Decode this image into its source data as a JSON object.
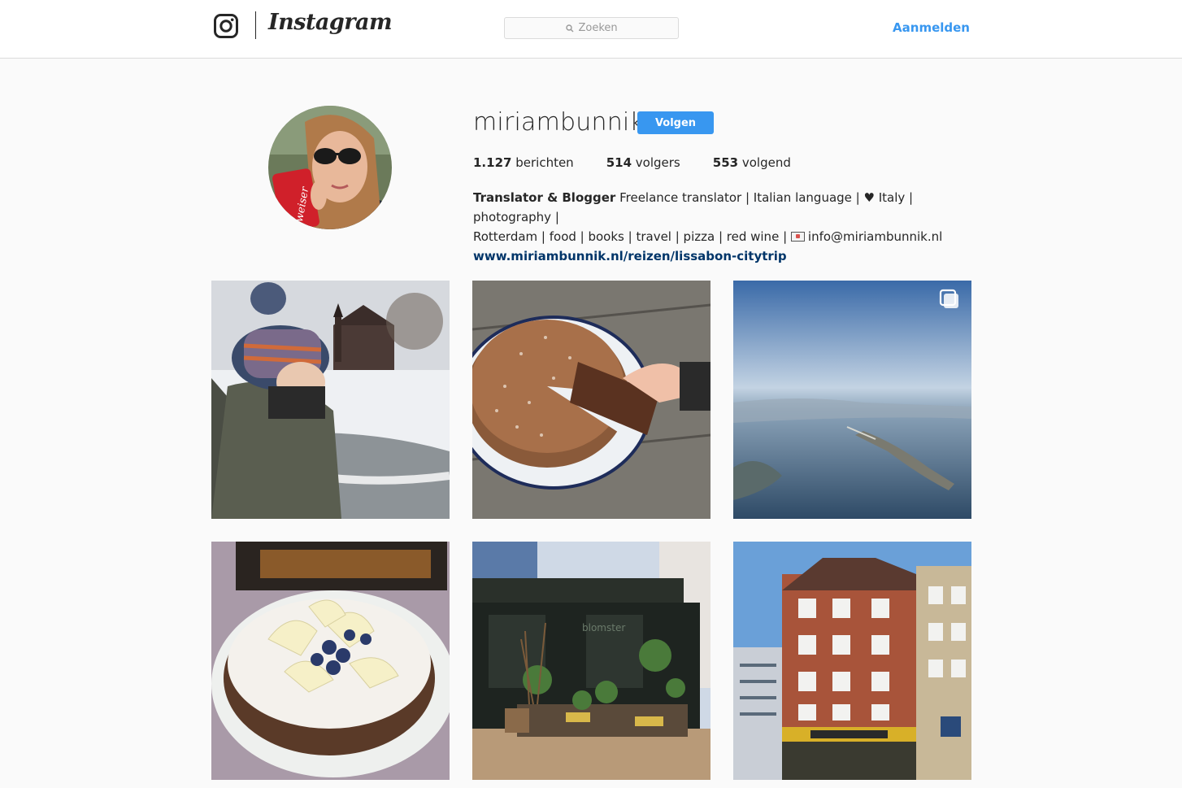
{
  "nav": {
    "brand": "Instagram",
    "search_placeholder": "Zoeken",
    "login_label": "Aanmelden"
  },
  "profile": {
    "username": "miriambunnik",
    "follow_label": "Volgen",
    "stats": [
      {
        "count": "1.127",
        "label": "berichten"
      },
      {
        "count": "514",
        "label": "volgers"
      },
      {
        "count": "553",
        "label": "volgend"
      }
    ],
    "bio": {
      "name": "Translator & Blogger",
      "line1": "Freelance translator | Italian language | ♥ Italy | photography |",
      "line2_prefix": "Rotterdam | food | books | travel | pizza | red wine |",
      "email": "info@miriambunnik.nl",
      "website": "www.miriambunnik.nl/reizen/lissabon-citytrip"
    }
  },
  "posts": [
    {
      "subject": "child in knit hat by frozen pond with church",
      "multi": false
    },
    {
      "subject": "chocolate cake with slice being taken",
      "multi": false
    },
    {
      "subject": "aerial view of coastline and bridge",
      "multi": true
    },
    {
      "subject": "cake with white chocolate and blueberries",
      "multi": false
    },
    {
      "subject": "flower shop storefront with plants",
      "multi": false
    },
    {
      "subject": "brick building with granola café",
      "multi": false
    }
  ],
  "colors": {
    "accent": "#3897f0",
    "link": "#003569",
    "background": "#fafafa",
    "border": "#dbdbdb"
  },
  "icons": {
    "logo": "instagram-glyph-icon",
    "search": "search-icon",
    "multi_post": "multiple-photos-icon"
  }
}
